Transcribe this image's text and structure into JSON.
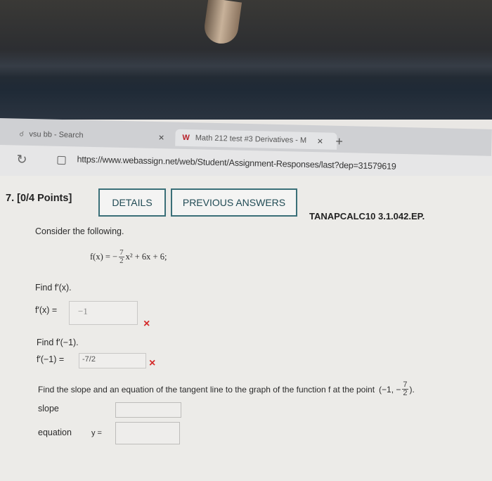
{
  "browser": {
    "tab_search": "vsu bb - Search",
    "tab_active": "Math 212 test #3 Derivatives - M",
    "tab_close": "×",
    "new_tab": "+",
    "url": "https://www.webassign.net/web/Student/Assignment-Responses/last?dep=31579619"
  },
  "question": {
    "number": "7. [0/4 Points]",
    "details_label": "DETAILS",
    "previous_answers_label": "PREVIOUS ANSWERS",
    "code": "TANAPCALC10 3.1.042.EP.",
    "intro": "Consider the following.",
    "function_lhs": "f(x) = −",
    "frac_num": "7",
    "frac_den": "2",
    "function_rhs": "x² + 6x + 6;",
    "find1": "Find f′(x).",
    "label1": "f′(x) =",
    "answer1": "−1",
    "find2": "Find f′(−1).",
    "label2": "f′(−1) =",
    "answer2": "-7/2",
    "wrong_mark": "×",
    "tangent_prompt": "Find the slope and an equation of the tangent line to the graph of the function f at the point",
    "point_open": "(−1, −",
    "point_frac_num": "7",
    "point_frac_den": "2",
    "point_close": ").",
    "slope_label": "slope",
    "slope_value": "",
    "equation_label": "equation",
    "y_label": "y =",
    "equation_value": ""
  }
}
